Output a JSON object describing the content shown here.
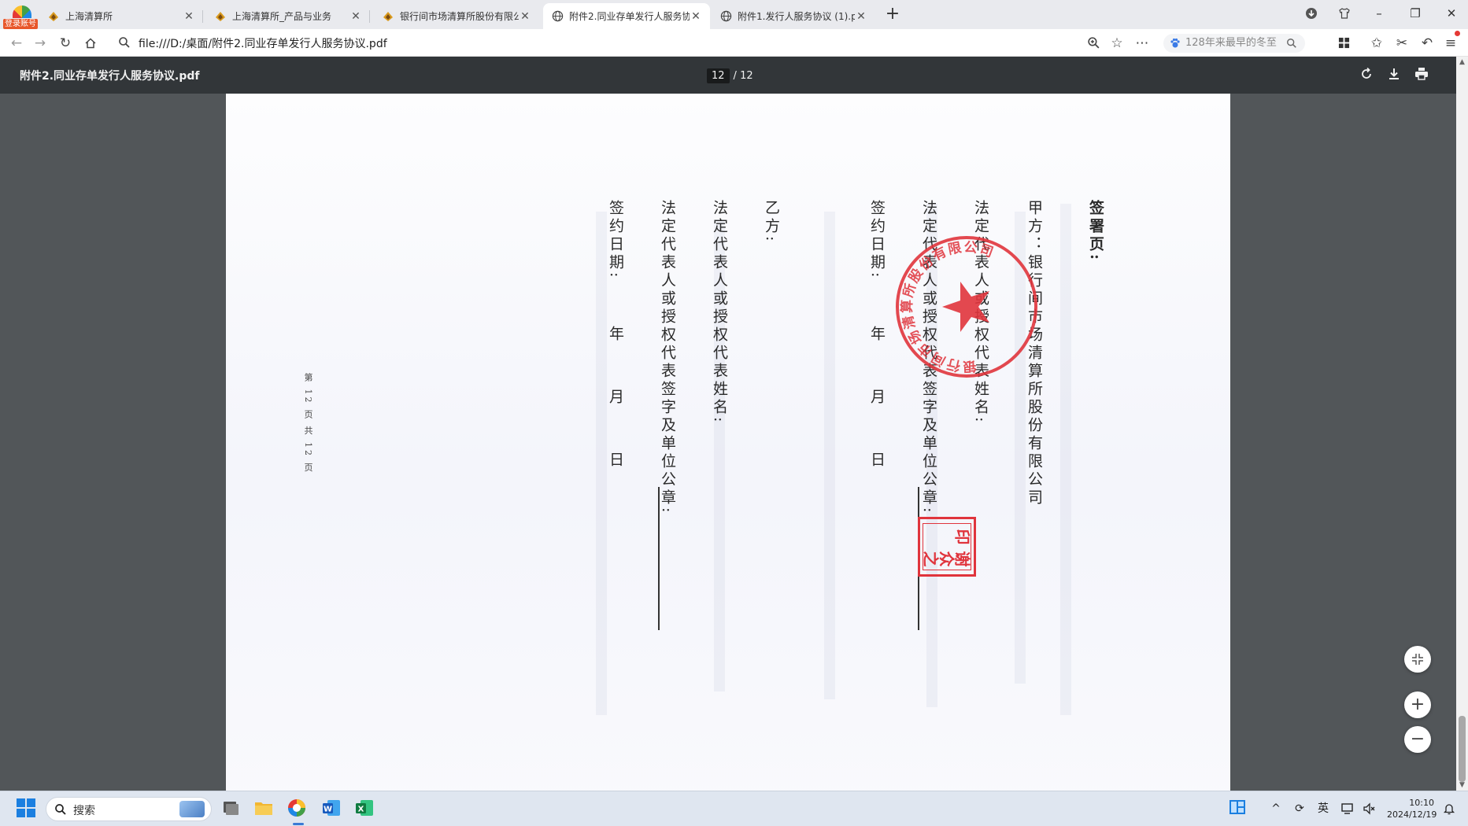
{
  "browser": {
    "profile_badge": "登录账号",
    "tabs": [
      {
        "title": "上海清算所",
        "icon": "shclearing-favicon",
        "active": false
      },
      {
        "title": "上海清算所_产品与业务",
        "icon": "shclearing-favicon",
        "active": false
      },
      {
        "title": "银行间市场清算所股份有限公",
        "icon": "shclearing-favicon",
        "active": false
      },
      {
        "title": "附件2.同业存单发行人服务协",
        "icon": "globe-icon",
        "active": true
      },
      {
        "title": "附件1.发行人服务协议 (1).pdf",
        "icon": "globe-icon",
        "active": false
      }
    ],
    "address": "file:///D:/桌面/附件2.同业存单发行人服务协议.pdf",
    "hot_search": "128年来最早的冬至"
  },
  "pdf": {
    "file_name": "附件2.同业存单发行人服务协议.pdf",
    "current_page": "12",
    "page_separator": "/",
    "total_pages": "12"
  },
  "document": {
    "heading": "签署页:",
    "party_a": "甲方：银行间市场清算所股份有限公司",
    "rep_name_a": "法定代表人或授权代表姓名:",
    "rep_sign_a": "法定代表人或授权代表签字及单位公章:",
    "sign_date_a": "签约日期:",
    "date_year_a": "年",
    "date_month_a": "月",
    "date_day_a": "日",
    "party_b": "乙方:",
    "rep_name_b": "法定代表人或授权代表姓名:",
    "rep_sign_b": "法定代表人或授权代表签字及单位公章:",
    "sign_date_b": "签约日期:",
    "date_year_b": "年",
    "date_month_b": "月",
    "date_day_b": "日",
    "page_footer": "第 12 页 共 12 页",
    "seal_text": "银行间市场清算所股份有限公司",
    "stamp_text": "谢众之印",
    "seal_color": "#e0343c"
  },
  "taskbar": {
    "search_label": "搜索",
    "ime": "英",
    "time": "10:10",
    "date": "2024/12/19"
  }
}
